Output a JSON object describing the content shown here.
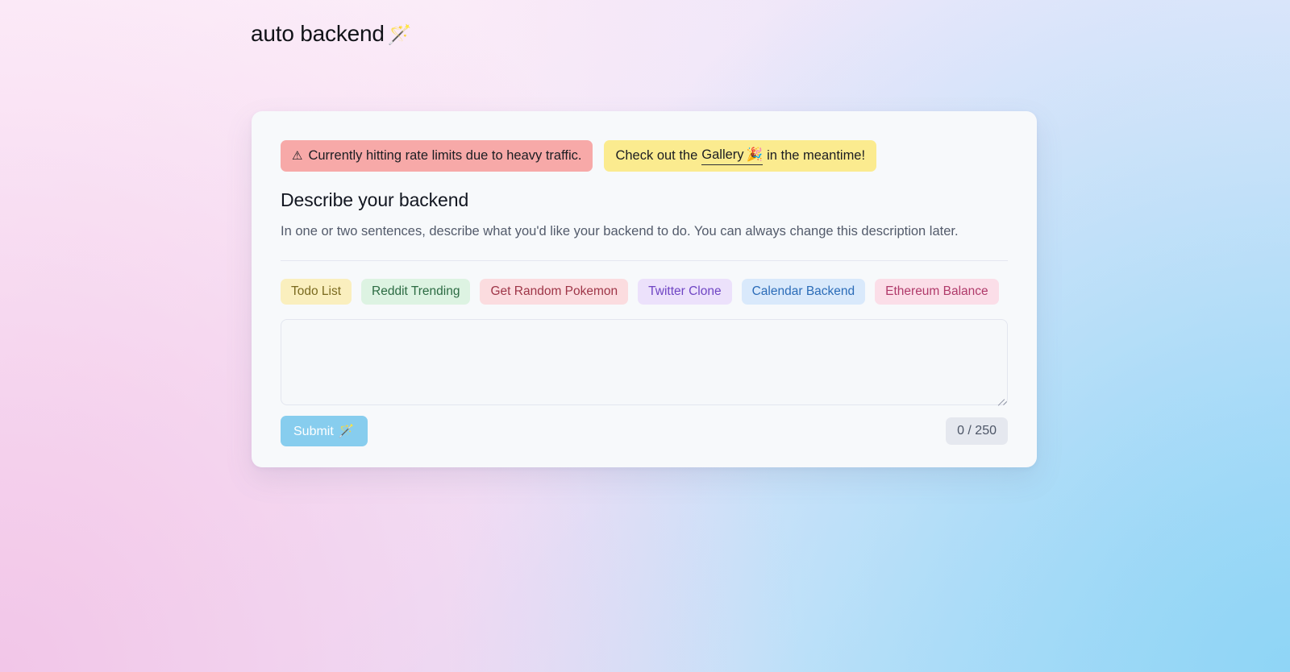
{
  "brand": {
    "name": "auto backend",
    "icon": "🪄"
  },
  "banners": {
    "alert": {
      "icon": "⚠",
      "text": "Currently hitting rate limits due to heavy traffic."
    },
    "info": {
      "prefix": "Check out the",
      "link": "Gallery",
      "link_icon": "🎉",
      "suffix": "in the meantime!"
    }
  },
  "form": {
    "title": "Describe your backend",
    "subtitle": "In one or two sentences, describe what you'd like your backend to do. You can always change this description later.",
    "textarea_value": "",
    "textarea_placeholder": "",
    "submit_label": "Submit",
    "submit_icon": "🪄",
    "counter": "0 / 250"
  },
  "chips": [
    {
      "label": "Todo List",
      "bg": "#faefbe",
      "fg": "#7a6a1f"
    },
    {
      "label": "Reddit Trending",
      "bg": "#ddf3e2",
      "fg": "#2c6b43"
    },
    {
      "label": "Get Random Pokemon",
      "bg": "#fbdcdf",
      "fg": "#9e3547"
    },
    {
      "label": "Twitter Clone",
      "bg": "#ece1fb",
      "fg": "#6f45c4"
    },
    {
      "label": "Calendar Backend",
      "bg": "#d9e9fb",
      "fg": "#2b6cb8"
    },
    {
      "label": "Ethereum Balance",
      "bg": "#fbdee8",
      "fg": "#b03a6a"
    }
  ],
  "colors": {
    "alert_bg": "#f7a9a8",
    "info_bg": "#fbeb8f",
    "submit_bg": "#87cdee",
    "card_bg": "#f7f9fb",
    "counter_bg": "#e5e8ef"
  }
}
